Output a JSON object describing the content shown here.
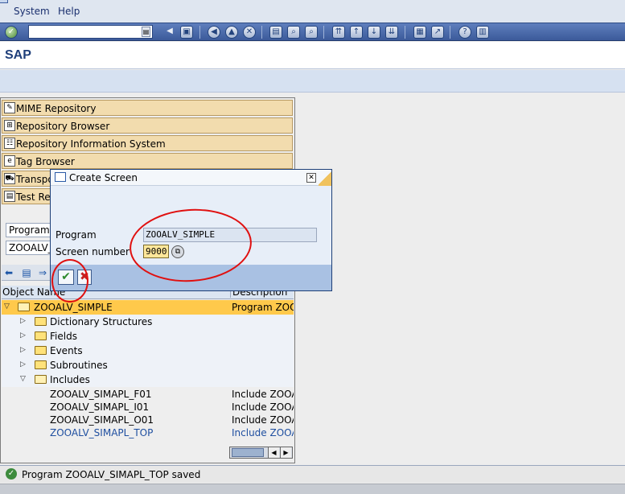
{
  "menubar": {
    "items": [
      "System",
      "Help"
    ]
  },
  "toolbar": {
    "command_field": "",
    "icons": [
      "enter-icon",
      "back-icon",
      "save-icon",
      "back-nav-icon",
      "exit-icon",
      "cancel-icon",
      "print-icon",
      "find-icon",
      "find-next-icon",
      "first-page-icon",
      "prev-page-icon",
      "next-page-icon",
      "last-page-icon",
      "new-session-icon",
      "shortcut-icon",
      "help-icon",
      "layout-icon"
    ]
  },
  "title": "SAP",
  "navigator": {
    "buttons": [
      {
        "label": "MIME Repository",
        "icon": "mime-repository-icon"
      },
      {
        "label": "Repository Browser",
        "icon": "repository-browser-icon"
      },
      {
        "label": "Repository Information System",
        "icon": "info-system-icon"
      },
      {
        "label": "Tag Browser",
        "icon": "tag-browser-icon"
      },
      {
        "label": "Transpo",
        "icon": "transport-icon"
      },
      {
        "label": "Test Re",
        "icon": "test-repository-icon"
      }
    ],
    "object_type": "Program",
    "object_name": "ZOOALV_",
    "tree_headers": {
      "name": "Object Name",
      "description": "Description"
    },
    "tree": [
      {
        "label": "ZOOALV_SIMPLE",
        "desc": "Program ZOO",
        "level": 0,
        "expanded": true,
        "selected": true
      },
      {
        "label": "Dictionary Structures",
        "desc": "",
        "level": 1
      },
      {
        "label": "Fields",
        "desc": "",
        "level": 1
      },
      {
        "label": "Events",
        "desc": "",
        "level": 1
      },
      {
        "label": "Subroutines",
        "desc": "",
        "level": 1
      },
      {
        "label": "Includes",
        "desc": "",
        "level": 1,
        "expanded": true
      },
      {
        "label": "ZOOALV_SIMAPL_F01",
        "desc": "Include ZOOA",
        "level": 2
      },
      {
        "label": "ZOOALV_SIMAPL_I01",
        "desc": "Include ZOOA",
        "level": 2
      },
      {
        "label": "ZOOALV_SIMAPL_O01",
        "desc": "Include ZOOA",
        "level": 2
      },
      {
        "label": "ZOOALV_SIMAPL_TOP",
        "desc": "Include ZOOA",
        "level": 2,
        "highlight": true
      }
    ]
  },
  "dialog": {
    "title": "Create Screen",
    "program_label": "Program",
    "program_value": "ZOOALV_SIMPLE",
    "screen_label": "Screen number",
    "screen_value": "9000"
  },
  "status": {
    "message": "Program ZOOALV_SIMAPL_TOP saved",
    "type": "success"
  },
  "colors": {
    "selected_row": "#ffc94b",
    "nav_button": "#f2dcae",
    "dialog_buttonbar": "#a9c1e3",
    "annotation": "#e01010"
  }
}
